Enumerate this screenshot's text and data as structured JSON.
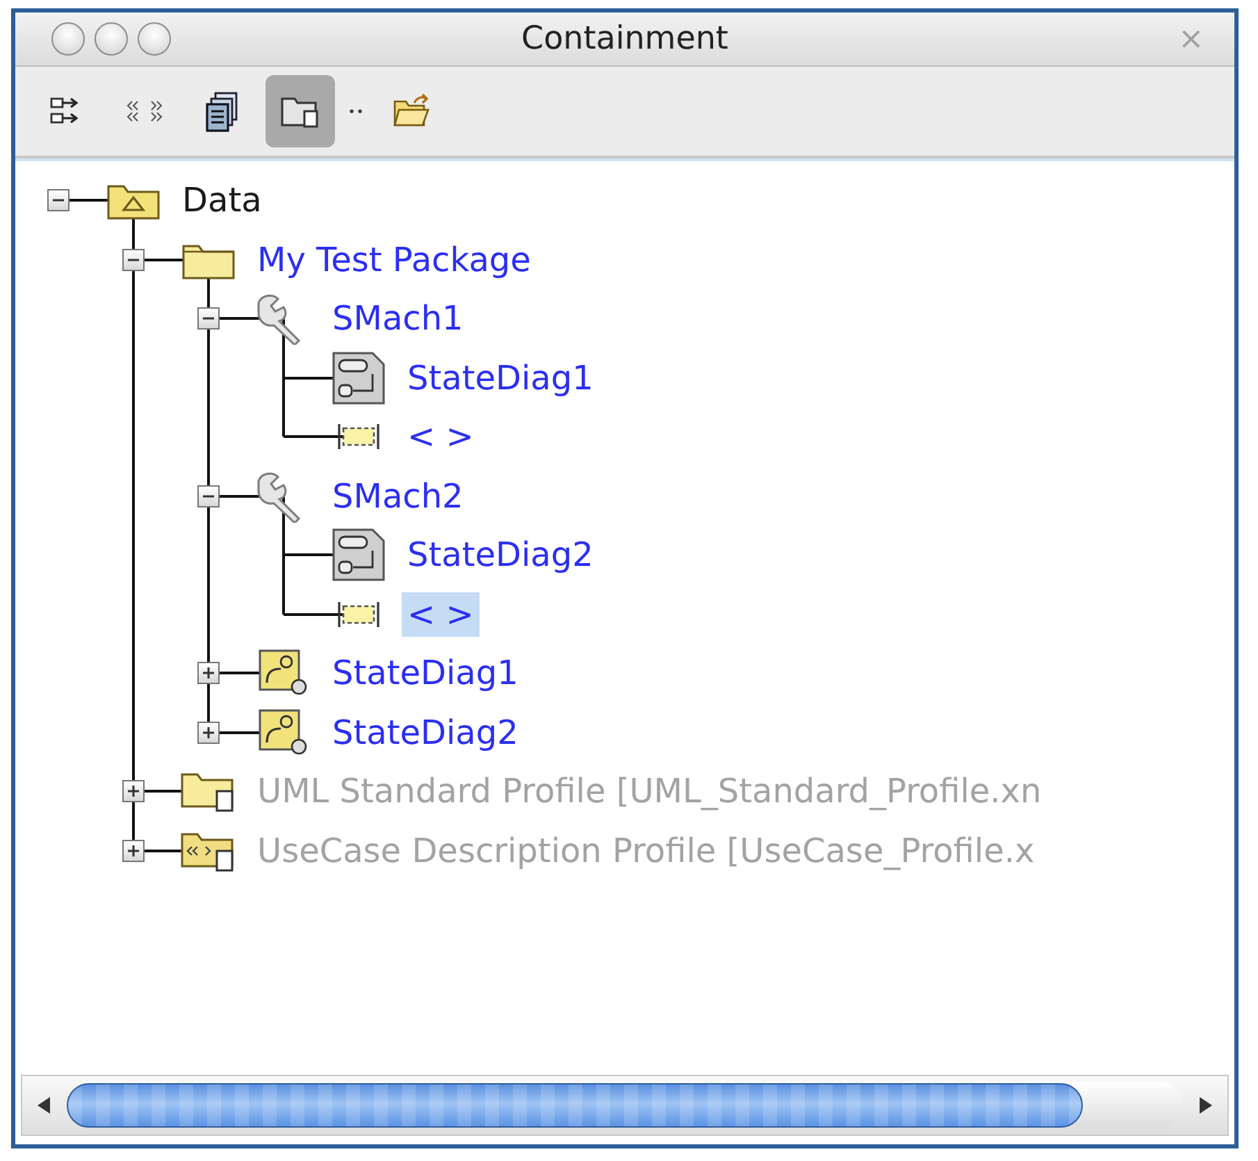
{
  "window": {
    "title": "Containment",
    "close": "×"
  },
  "toolbar": [
    {
      "kind": "arrows",
      "pressed": false
    },
    {
      "kind": "stereotype",
      "pressed": false
    },
    {
      "kind": "documents",
      "pressed": false
    },
    {
      "kind": "folder-doc",
      "pressed": true
    },
    {
      "kind": "separator",
      "pressed": false
    },
    {
      "kind": "open-folder",
      "pressed": false
    }
  ],
  "tree": [
    {
      "label": "Data",
      "kind": "data",
      "expanded": true,
      "selected": false,
      "disabled": false,
      "children": [
        {
          "label": "My Test Package",
          "kind": "package",
          "expanded": true,
          "selected": false,
          "disabled": false,
          "children": [
            {
              "label": "SMach1",
              "kind": "state-machine",
              "expanded": true,
              "selected": false,
              "disabled": false,
              "children": [
                {
                  "label": "StateDiag1",
                  "kind": "state-diagram",
                  "selected": false,
                  "disabled": false
                },
                {
                  "label": "< >",
                  "kind": "region",
                  "selected": false,
                  "disabled": false
                }
              ]
            },
            {
              "label": "SMach2",
              "kind": "state-machine",
              "expanded": true,
              "selected": false,
              "disabled": false,
              "children": [
                {
                  "label": "StateDiag2",
                  "kind": "state-diagram",
                  "selected": false,
                  "disabled": false
                },
                {
                  "label": "< >",
                  "kind": "region",
                  "selected": true,
                  "disabled": false
                }
              ]
            },
            {
              "label": "StateDiag1",
              "kind": "diagram",
              "expanded": false,
              "selected": false,
              "disabled": false
            },
            {
              "label": "StateDiag2",
              "kind": "diagram",
              "expanded": false,
              "selected": false,
              "disabled": false
            }
          ]
        },
        {
          "label": "UML Standard Profile [UML_Standard_Profile.xn",
          "kind": "profile",
          "expanded": false,
          "selected": false,
          "disabled": true
        },
        {
          "label": "UseCase Description Profile [UseCase_Profile.x",
          "kind": "usecase-profile",
          "expanded": false,
          "selected": false,
          "disabled": true
        }
      ]
    }
  ]
}
